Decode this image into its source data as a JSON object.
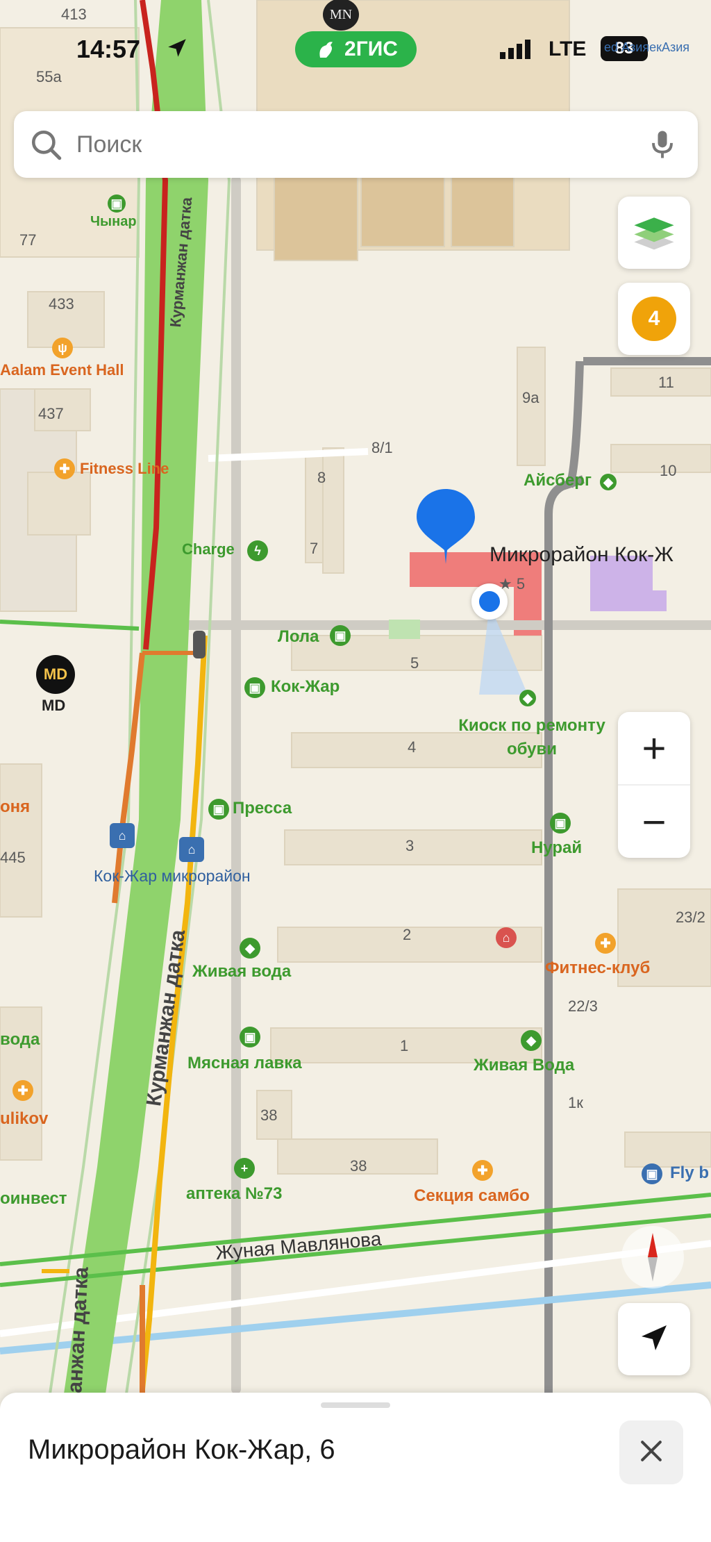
{
  "status_bar": {
    "time": "14:57",
    "app_badge": "2ГИС",
    "top_logo": "MN",
    "network": "LTE",
    "battery": "83"
  },
  "search": {
    "placeholder": "Поиск"
  },
  "controls": {
    "notifications_count": "4",
    "zoom_in": "+",
    "zoom_out": "−"
  },
  "map": {
    "streets": {
      "main_vertical": "Курманжан датка",
      "main_vertical_top": "Курманжан датка",
      "main_vertical_bottom": "Манжан датка",
      "horizontal": "Жуная Мавлянова"
    },
    "pois": {
      "chynar": "Чынар",
      "aalam": "Aalam Event Hall",
      "fitness_line": "Fitness Line",
      "charge": "Charge",
      "lola": "Лола",
      "kok_zhar_shop": "Кок-Жар",
      "pressa": "Пресса",
      "bus_stop": "Кок-Жар микрорайон",
      "zhivaya_voda": "Живая вода",
      "myasnaya": "Мясная лавка",
      "apteka": "аптека №73",
      "sekciya": "Секция самбо",
      "fitness_club": "Фитнес-клуб",
      "zhivaya_voda2": "Живая Вода",
      "nurai": "Нурай",
      "kiosk": "Киоск по ремонту обуви",
      "aisberg": "Айсберг",
      "selected": "Микрорайон Кок-Ж",
      "left_nya": "оня",
      "left_voda": "вода",
      "left_ulikov": "ulikov",
      "left_invest": "оинвест",
      "fly": "Fly b",
      "md": "MD",
      "top_right": "ed АзияекАзия"
    },
    "numbers": [
      "413",
      "55а",
      "77",
      "433",
      "437",
      "445",
      "8/1",
      "8",
      "7",
      "9а",
      "11",
      "10",
      "5",
      "4",
      "3",
      "2",
      "1",
      "38",
      "38",
      "1к",
      "22/3",
      "23/2"
    ],
    "rating": "5"
  },
  "bottom_sheet": {
    "title": "Микрорайон Кок-Жар, 6"
  },
  "colors": {
    "map_bg": "#f3efe4",
    "green_strip": "#8fd36c",
    "traffic_red": "#c8231e",
    "traffic_orange": "#e07a2e",
    "traffic_yellow": "#f2b50f",
    "pin_blue": "#1a73e8",
    "badge_green": "#2bb34a",
    "badge_orange": "#f0a30a"
  }
}
